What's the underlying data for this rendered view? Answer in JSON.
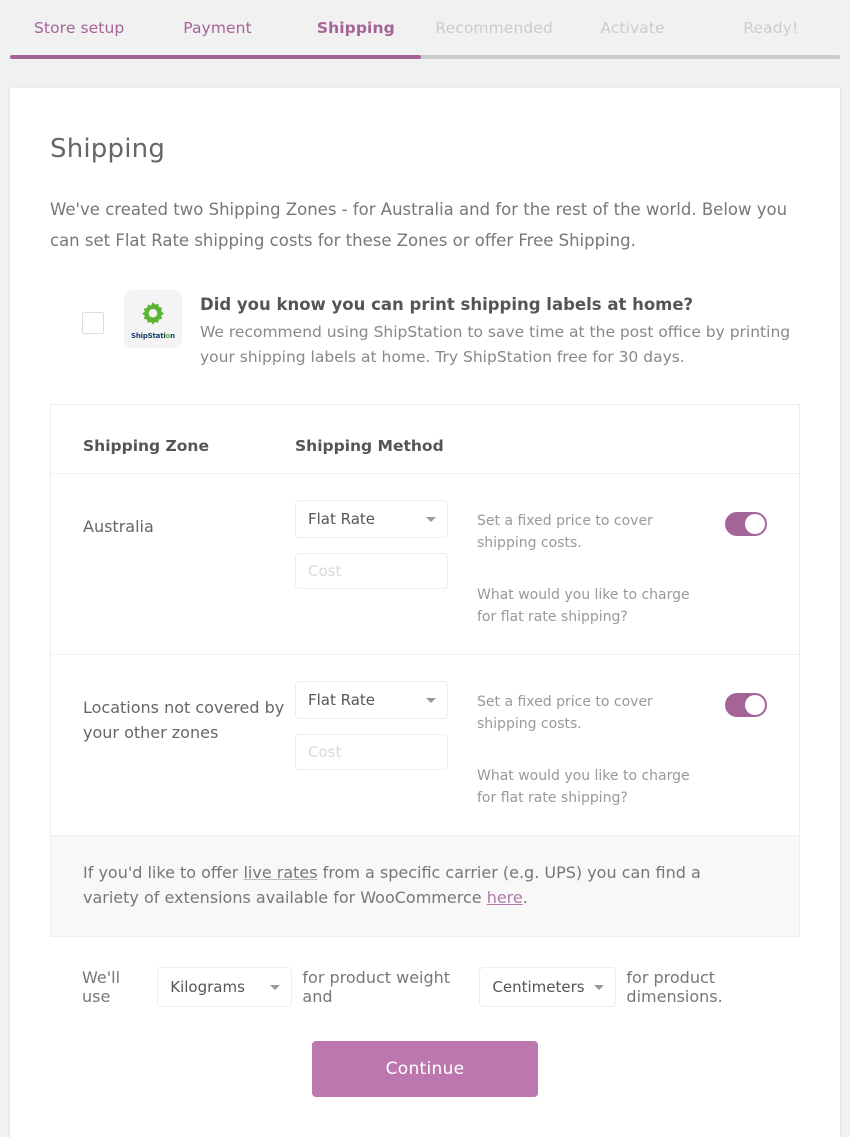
{
  "theme": {
    "accent": "#a46497",
    "button": "#bb77ae",
    "page_bg": "#f1f1f1",
    "muted": "#ccc"
  },
  "steps": [
    {
      "label": "Store setup",
      "state": "done"
    },
    {
      "label": "Payment",
      "state": "done"
    },
    {
      "label": "Shipping",
      "state": "current"
    },
    {
      "label": "Recommended",
      "state": "todo"
    },
    {
      "label": "Activate",
      "state": "todo"
    },
    {
      "label": "Ready!",
      "state": "todo"
    }
  ],
  "main": {
    "title": "Shipping",
    "intro": "We've created two Shipping Zones - for Australia and for the rest of the world. Below you can set Flat Rate shipping costs for these Zones or offer Free Shipping."
  },
  "shipstation": {
    "logo_text_a": "ShipStati",
    "logo_text_o": "o",
    "logo_text_b": "n",
    "title": "Did you know you can print shipping labels at home?",
    "description": "We recommend using ShipStation to save time at the post office by printing your shipping labels at home. Try ShipStation free for 30 days."
  },
  "zones_table": {
    "headers": {
      "zone": "Shipping Zone",
      "method": "Shipping Method"
    },
    "rows": [
      {
        "zone": "Australia",
        "method_value": "Flat Rate",
        "cost_value": "",
        "cost_placeholder": "Cost",
        "desc_method": "Set a fixed price to cover shipping costs.",
        "desc_cost": "What would you like to charge for flat rate shipping?",
        "enabled": true
      },
      {
        "zone": "Locations not covered by your other zones",
        "method_value": "Flat Rate",
        "cost_value": "",
        "cost_placeholder": "Cost",
        "desc_method": "Set a fixed price to cover shipping costs.",
        "desc_cost": "What would you like to charge for flat rate shipping?",
        "enabled": true
      }
    ],
    "footer": {
      "text_before": "If you'd like to offer ",
      "tooltip_link": "live rates",
      "text_middle": " from a specific carrier (e.g. UPS) you can find a variety of extensions available for WooCommerce ",
      "link": "here",
      "text_after": "."
    }
  },
  "units": {
    "prefix": "We'll use",
    "weight_value": "Kilograms",
    "middle": "for product weight and",
    "dimension_value": "Centimeters",
    "suffix": "for product dimensions."
  },
  "actions": {
    "continue_label": "Continue"
  }
}
